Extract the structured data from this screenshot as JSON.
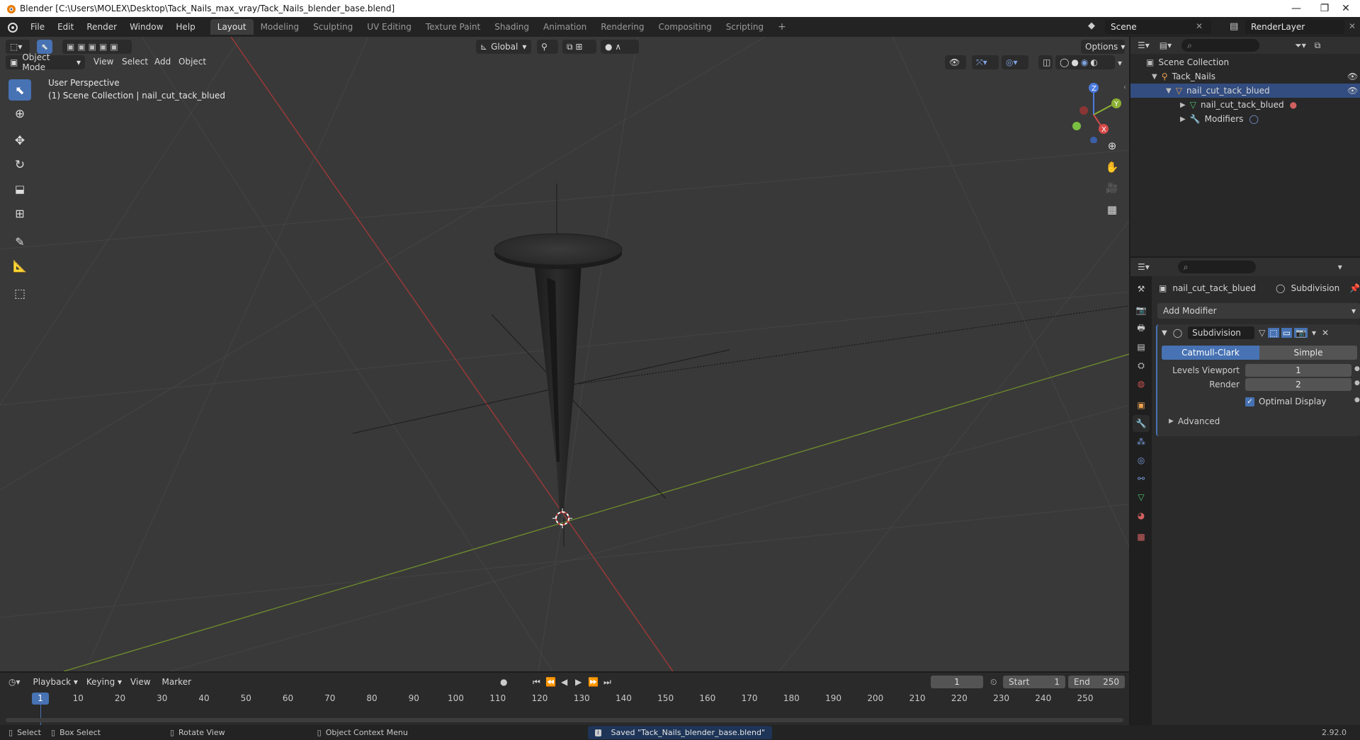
{
  "window": {
    "title": "Blender [C:\\Users\\MOLEX\\Desktop\\Tack_Nails_max_vray/Tack_Nails_blender_base.blend]",
    "controls": [
      "—",
      "❐",
      "✕"
    ]
  },
  "menu": [
    "File",
    "Edit",
    "Render",
    "Window",
    "Help"
  ],
  "workspaces": [
    "Layout",
    "Modeling",
    "Sculpting",
    "UV Editing",
    "Texture Paint",
    "Shading",
    "Animation",
    "Rendering",
    "Compositing",
    "Scripting"
  ],
  "active_workspace": "Layout",
  "scene": {
    "name": "Scene",
    "view_layer": "RenderLayer"
  },
  "viewport": {
    "mode": "Object Mode",
    "menus": [
      "View",
      "Select",
      "Add",
      "Object"
    ],
    "orientation": "Global",
    "options_label": "Options",
    "overlay_line1": "User Perspective",
    "overlay_line2": "(1) Scene Collection | nail_cut_tack_blued",
    "gizmo": {
      "x": "X",
      "y": "Y",
      "z": "Z"
    }
  },
  "outliner": {
    "root": "Scene Collection",
    "items": [
      {
        "label": "Tack_Nails",
        "icon": "collection-icon"
      },
      {
        "label": "nail_cut_tack_blued",
        "icon": "object-icon"
      },
      {
        "label": "nail_cut_tack_blued",
        "icon": "mesh-data-icon"
      },
      {
        "label": "Modifiers",
        "icon": "wrench-icon"
      }
    ]
  },
  "properties": {
    "object_name": "nail_cut_tack_blued",
    "modifier_context": "Subdivision",
    "add_modifier": "Add Modifier",
    "modifier": {
      "name": "Subdivision",
      "type_options": [
        "Catmull-Clark",
        "Simple"
      ],
      "selected_type": "Catmull-Clark",
      "levels_viewport_label": "Levels Viewport",
      "levels_viewport": "1",
      "render_label": "Render",
      "render": "2",
      "optimal_display_label": "Optimal Display",
      "optimal_display": true,
      "advanced_label": "Advanced"
    }
  },
  "timeline": {
    "menus": [
      "Playback",
      "Keying",
      "View",
      "Marker"
    ],
    "current_frame": "1",
    "start_label": "Start",
    "start": "1",
    "end_label": "End",
    "end": "250",
    "ruler": [
      "1",
      "10",
      "20",
      "30",
      "40",
      "50",
      "60",
      "70",
      "80",
      "90",
      "100",
      "110",
      "120",
      "130",
      "140",
      "150",
      "160",
      "170",
      "180",
      "190",
      "200",
      "210",
      "220",
      "230",
      "240",
      "250"
    ]
  },
  "statusbar": {
    "select": "Select",
    "box_select": "Box Select",
    "rotate_view": "Rotate View",
    "context_menu": "Object Context Menu",
    "message": "Saved \"Tack_Nails_blender_base.blend\"",
    "version": "2.92.0"
  },
  "colors": {
    "accent": "#4772b3",
    "x_axis": "#d84a4a",
    "y_axis": "#8cb033",
    "z_axis": "#4a7be0"
  }
}
